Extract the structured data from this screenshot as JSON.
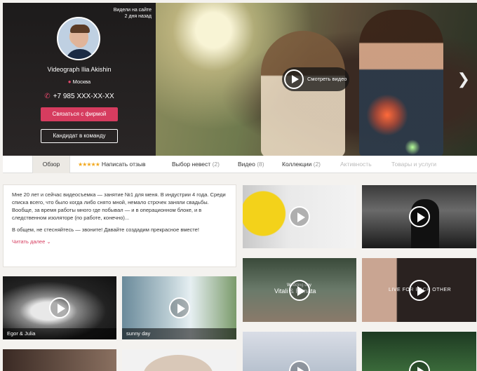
{
  "profile": {
    "seen_line1": "Видели на сайте",
    "seen_line2": "2 дня назад",
    "name": "Videograph Ilia Akishin",
    "city": "Москва",
    "phone": "+7 985 XXX-XX-XX",
    "contact_button": "Связаться с фирмой",
    "team_button": "Кандидат в команду"
  },
  "hero": {
    "watch_label": "Смотреть видео"
  },
  "tabs": [
    {
      "label": "Обзор",
      "count": ""
    },
    {
      "label": "Написать отзыв",
      "count": ""
    },
    {
      "label": "Выбор невест",
      "count": "(2)"
    },
    {
      "label": "Видео",
      "count": "(8)"
    },
    {
      "label": "Коллекции",
      "count": "(2)"
    },
    {
      "label": "Активность",
      "count": ""
    },
    {
      "label": "Товары и услуги",
      "count": ""
    }
  ],
  "stars": "★★★★★",
  "about": {
    "paragraph1": "Мне 20 лет и сейчас видеосъемка — занятие №1 для меня. В индустрии 4 года. Среди списка всего, что было когда либо снято мной, немало строчек заняли свадьбы. Вообще, за время работы много где побывал — и в операционном блоке, и в следственном изоляторе (по работе, конечно)...",
    "paragraph2": "В общем, не стесняйтесь — звоните! Давайте создадим прекрасное вместе!",
    "read_more": "Читать далее"
  },
  "videos": {
    "captions": [
      "Egor & Julia",
      "sunny day"
    ],
    "overlay_wedding_day": "Wedding day",
    "overlay_names": "Vitali & Renata",
    "overlay_live": "LIVE FOR EACH OTHER"
  },
  "colors": {
    "accent": "#d63c5f",
    "star": "#f2a81d"
  }
}
